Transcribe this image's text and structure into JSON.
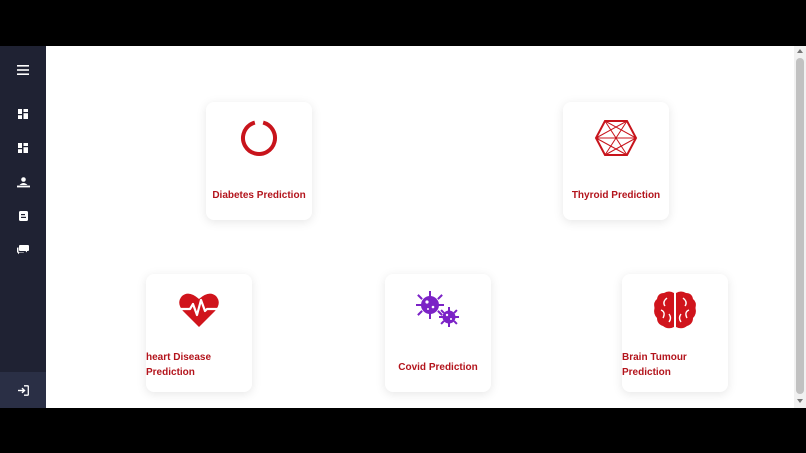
{
  "sidebar": {
    "items": [
      {
        "name": "menu",
        "icon": "hamburger-menu-icon"
      },
      {
        "name": "dashboard",
        "icon": "dashboard-icon"
      },
      {
        "name": "dashboard-2",
        "icon": "dashboard-icon"
      },
      {
        "name": "patient",
        "icon": "patient-bed-icon"
      },
      {
        "name": "blog",
        "icon": "blog-icon"
      },
      {
        "name": "chat",
        "icon": "chat-icon"
      }
    ],
    "bottom_icon": "sign-in-icon"
  },
  "header": {
    "logout_icon": "sign-out-icon"
  },
  "cards": [
    {
      "label": "Diabetes Prediction",
      "icon": "ring-icon",
      "color": "#c8141c"
    },
    {
      "label": "Thyroid Prediction",
      "icon": "thyroid-network-icon",
      "color": "#c8141c"
    },
    {
      "label_line1": "heart Disease",
      "label_line2": "Prediction",
      "icon": "heartbeat-icon",
      "color": "#d0141c"
    },
    {
      "label": "Covid Prediction",
      "icon": "virus-icon",
      "color": "#7b22c6"
    },
    {
      "label_line1": "Brain Tumour",
      "label_line2": "Prediction",
      "icon": "brain-icon",
      "color": "#d0141c"
    }
  ],
  "colors": {
    "sidebar": "#1f2233",
    "accent_red": "#b3141c",
    "accent_purple": "#7b22c6"
  }
}
